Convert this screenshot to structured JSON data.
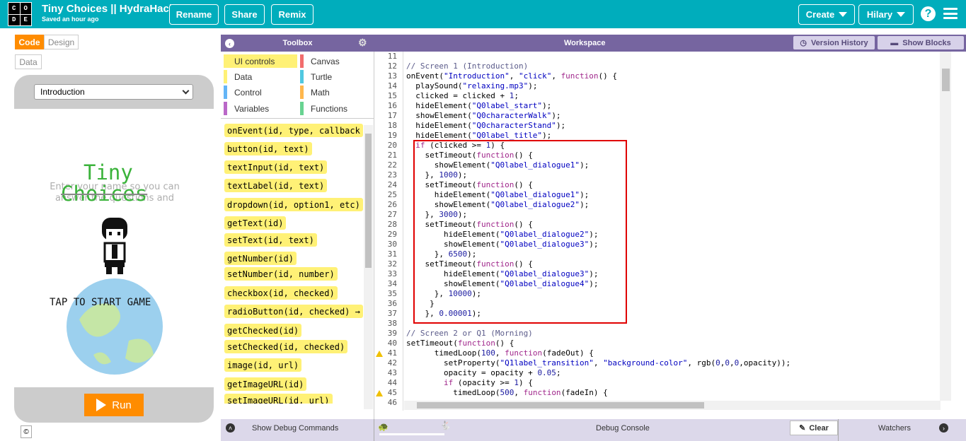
{
  "header": {
    "logo_letters": [
      "C",
      "O",
      "D",
      "E"
    ],
    "title": "Tiny Choices || HydraHacks",
    "saved": "Saved an hour ago",
    "rename": "Rename",
    "share": "Share",
    "remix": "Remix",
    "create": "Create",
    "user": "Hilary",
    "help": "?"
  },
  "left": {
    "code_tab": "Code",
    "design_tab": "Design",
    "data_tab": "Data",
    "screen_select": "Introduction",
    "app": {
      "title_line1": "Tiny",
      "title_line2": "Choices",
      "ghost_text": "Enter your name so you can answer the questions and",
      "tap_text": "TAP TO START GAME"
    },
    "run": "Run",
    "copyright": "©"
  },
  "toolbox": {
    "header": "Toolbox",
    "categories": [
      {
        "label": "UI controls",
        "color": "#fff176"
      },
      {
        "label": "Canvas",
        "color": "#f26d6d"
      },
      {
        "label": "Data",
        "color": "#fff176"
      },
      {
        "label": "Turtle",
        "color": "#50c8e0"
      },
      {
        "label": "Control",
        "color": "#64b5f6"
      },
      {
        "label": "Math",
        "color": "#ffb74d"
      },
      {
        "label": "Variables",
        "color": "#ba68c8"
      },
      {
        "label": "Functions",
        "color": "#68d391"
      }
    ],
    "blocks": [
      "onEvent(id, type, callback",
      "button(id, text)",
      "textInput(id, text)",
      "textLabel(id, text)",
      "dropdown(id, option1, etc)",
      "getText(id)",
      "setText(id, text)",
      "getNumber(id)",
      "setNumber(id, number)",
      "checkbox(id, checked)",
      "radioButton(id, checked) →",
      "getChecked(id)",
      "setChecked(id, checked)",
      "image(id, url)",
      "getImageURL(id)",
      "setImageURL(id, url)"
    ]
  },
  "workspace": {
    "header": "Workspace",
    "version_history": "Version History",
    "show_blocks": "Show Blocks",
    "line_numbers": [
      "11",
      "12",
      "13",
      "14",
      "15",
      "16",
      "17",
      "18",
      "19",
      "20",
      "21",
      "22",
      "23",
      "24",
      "25",
      "26",
      "27",
      "28",
      "29",
      "30",
      "31",
      "32",
      "33",
      "34",
      "35",
      "36",
      "37",
      "38",
      "39",
      "40",
      "41",
      "42",
      "43",
      "44",
      "45",
      "46"
    ],
    "warning_lines": [
      "41",
      "45"
    ],
    "code_lines": [
      [],
      [
        [
          "cm",
          "// Screen 1 (Introduction)"
        ]
      ],
      [
        [
          "",
          "onEvent("
        ],
        [
          "st",
          "\"Introduction\""
        ],
        [
          "",
          ", "
        ],
        [
          "st",
          "\"click\""
        ],
        [
          "",
          ", "
        ],
        [
          "kw",
          "function"
        ],
        [
          "",
          "() {"
        ]
      ],
      [
        [
          "",
          "  playSound("
        ],
        [
          "st",
          "\"relaxing.mp3\""
        ],
        [
          "",
          ");"
        ]
      ],
      [
        [
          "",
          "  clicked = clicked + "
        ],
        [
          "nm",
          "1"
        ],
        [
          "",
          ";"
        ]
      ],
      [
        [
          "",
          "  hideElement("
        ],
        [
          "st",
          "\"Q0label_start\""
        ],
        [
          "",
          ");"
        ]
      ],
      [
        [
          "",
          "  showElement("
        ],
        [
          "st",
          "\"Q0characterWalk\""
        ],
        [
          "",
          ");"
        ]
      ],
      [
        [
          "",
          "  hideElement("
        ],
        [
          "st",
          "\"Q0characterStand\""
        ],
        [
          "",
          ");"
        ]
      ],
      [
        [
          "",
          "  hideElement("
        ],
        [
          "st",
          "\"Q0label_title\""
        ],
        [
          "",
          ");"
        ]
      ],
      [
        [
          "kw",
          "  if"
        ],
        [
          "",
          " (clicked >= "
        ],
        [
          "nm",
          "1"
        ],
        [
          "",
          ") {"
        ]
      ],
      [
        [
          "",
          "    setTimeout("
        ],
        [
          "kw",
          "function"
        ],
        [
          "",
          "() {"
        ]
      ],
      [
        [
          "",
          "      showElement("
        ],
        [
          "st",
          "\"Q0label_dialogue1\""
        ],
        [
          "",
          ");"
        ]
      ],
      [
        [
          "",
          "    }, "
        ],
        [
          "nm",
          "1000"
        ],
        [
          "",
          ");"
        ]
      ],
      [
        [
          "",
          "    setTimeout("
        ],
        [
          "kw",
          "function"
        ],
        [
          "",
          "() {"
        ]
      ],
      [
        [
          "",
          "      hideElement("
        ],
        [
          "st",
          "\"Q0label_dialogue1\""
        ],
        [
          "",
          ");"
        ]
      ],
      [
        [
          "",
          "      showElement("
        ],
        [
          "st",
          "\"Q0label_dialogue2\""
        ],
        [
          "",
          ");"
        ]
      ],
      [
        [
          "",
          "    }, "
        ],
        [
          "nm",
          "3000"
        ],
        [
          "",
          ");"
        ]
      ],
      [
        [
          "",
          "    setTimeout("
        ],
        [
          "kw",
          "function"
        ],
        [
          "",
          "() {"
        ]
      ],
      [
        [
          "",
          "        hideElement("
        ],
        [
          "st",
          "\"Q0label_dialogue2\""
        ],
        [
          "",
          ");"
        ]
      ],
      [
        [
          "",
          "        showElement("
        ],
        [
          "st",
          "\"Q0label_dialogue3\""
        ],
        [
          "",
          ");"
        ]
      ],
      [
        [
          "",
          "      }, "
        ],
        [
          "nm",
          "6500"
        ],
        [
          "",
          ");"
        ]
      ],
      [
        [
          "",
          "    setTimeout("
        ],
        [
          "kw",
          "function"
        ],
        [
          "",
          "() {"
        ]
      ],
      [
        [
          "",
          "        hideElement("
        ],
        [
          "st",
          "\"Q0label_dialogue3\""
        ],
        [
          "",
          ");"
        ]
      ],
      [
        [
          "",
          "        showElement("
        ],
        [
          "st",
          "\"Q0label_dialogue4\""
        ],
        [
          "",
          ");"
        ]
      ],
      [
        [
          "",
          "      }, "
        ],
        [
          "nm",
          "10000"
        ],
        [
          "",
          ");"
        ]
      ],
      [
        [
          "",
          "     }"
        ]
      ],
      [
        [
          "",
          "    }, "
        ],
        [
          "nm",
          "0.00001"
        ],
        [
          "",
          ");"
        ]
      ],
      [],
      [
        [
          "cm",
          "// Screen 2 or Q1 (Morning)"
        ]
      ],
      [
        [
          "",
          "setTimeout("
        ],
        [
          "kw",
          "function"
        ],
        [
          "",
          "() {"
        ]
      ],
      [
        [
          "",
          "      timedLoop("
        ],
        [
          "nm",
          "100"
        ],
        [
          "",
          ", "
        ],
        [
          "kw",
          "function"
        ],
        [
          "",
          "(fadeOut) {"
        ]
      ],
      [
        [
          "",
          "        setProperty("
        ],
        [
          "st",
          "\"Q1label_transition\""
        ],
        [
          "",
          ", "
        ],
        [
          "st",
          "\"background-color\""
        ],
        [
          "",
          ", rgb("
        ],
        [
          "nm",
          "0"
        ],
        [
          "",
          ","
        ],
        [
          "nm",
          "0"
        ],
        [
          "",
          ","
        ],
        [
          "nm",
          "0"
        ],
        [
          "",
          ",opacity));"
        ]
      ],
      [
        [
          "",
          "        opacity = opacity + "
        ],
        [
          "nm",
          "0.05"
        ],
        [
          "",
          ";"
        ]
      ],
      [
        [
          "kw",
          "        if"
        ],
        [
          "",
          " (opacity >= "
        ],
        [
          "nm",
          "1"
        ],
        [
          "",
          ") {"
        ]
      ],
      [
        [
          "",
          "          timedLoop("
        ],
        [
          "nm",
          "500"
        ],
        [
          "",
          ", "
        ],
        [
          "kw",
          "function"
        ],
        [
          "",
          "(fadeIn) {"
        ]
      ],
      []
    ]
  },
  "bottom": {
    "show_debug": "Show Debug Commands",
    "debug_console": "Debug Console",
    "clear": "Clear",
    "watchers": "Watchers"
  }
}
